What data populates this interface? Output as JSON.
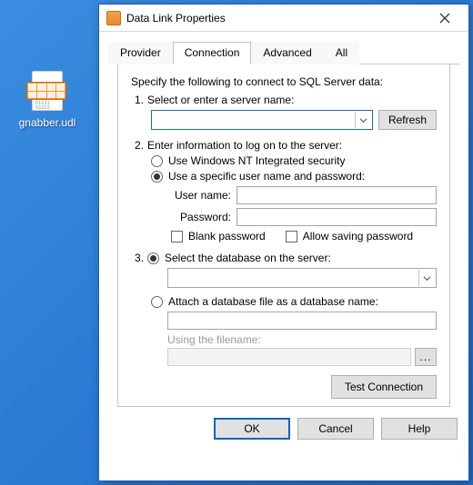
{
  "desktop": {
    "file_label": "gnabber.udl"
  },
  "dialog": {
    "title": "Data Link Properties",
    "tabs": [
      "Provider",
      "Connection",
      "Advanced",
      "All"
    ],
    "active_tab": 1,
    "instruction": "Specify the following to connect to SQL Server data:",
    "step1": {
      "num": "1.",
      "label": "Select or enter a server name:",
      "server_value": "",
      "refresh": "Refresh"
    },
    "step2": {
      "num": "2.",
      "label": "Enter information to log on to the server:",
      "opt_nt": "Use Windows NT Integrated security",
      "opt_userpass": "Use a specific user name and password:",
      "selected": "userpass",
      "username_label": "User name:",
      "username_value": "",
      "password_label": "Password:",
      "password_value": "",
      "blank_pw": "Blank password",
      "allow_save": "Allow saving password"
    },
    "step3": {
      "num": "3.",
      "opt_select_db": "Select the database on the server:",
      "opt_attach": "Attach a database file as a database name:",
      "selected": "select_db",
      "db_value": "",
      "attach_value": "",
      "using_label": "Using the filename:",
      "filename_value": "",
      "browse": "..."
    },
    "test_connection": "Test Connection",
    "buttons": {
      "ok": "OK",
      "cancel": "Cancel",
      "help": "Help"
    }
  }
}
